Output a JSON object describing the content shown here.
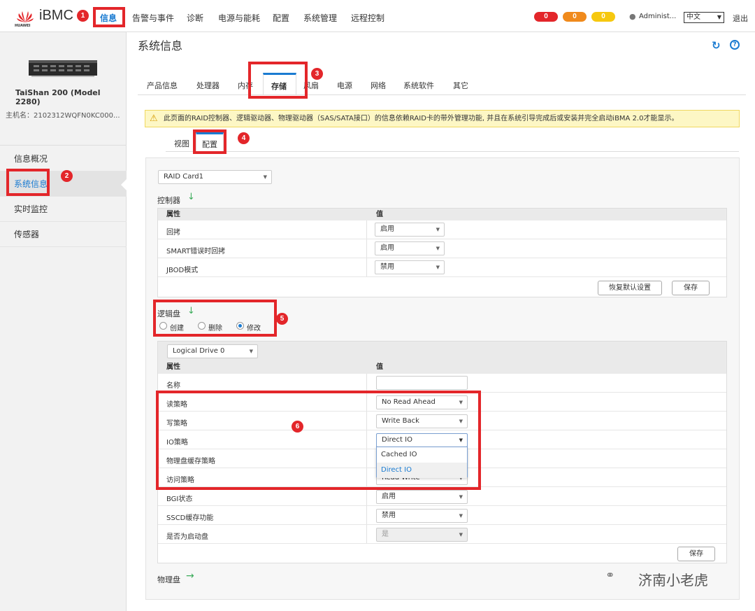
{
  "header": {
    "brand": "iBMC",
    "brand_sub": "HUAWEI",
    "nav": [
      "信息",
      "告警与事件",
      "诊断",
      "电源与能耗",
      "配置",
      "系统管理",
      "远程控制"
    ],
    "alarm_counts": [
      "0",
      "0",
      "0"
    ],
    "alarm_colors": [
      "#e3262a",
      "#f08a1c",
      "#f6c80f"
    ],
    "user": "Administ...",
    "language": "中文",
    "logout": "退出"
  },
  "sidebar": {
    "model": "TaiShan 200 (Model 2280)",
    "hostname": "主机名：2102312WQFN0KC000...",
    "items": [
      "信息概况",
      "系统信息",
      "实时监控",
      "传感器"
    ]
  },
  "main": {
    "title": "系统信息",
    "tabs": [
      "产品信息",
      "处理器",
      "内存",
      "存储",
      "风扇",
      "电源",
      "网络",
      "系统软件",
      "其它"
    ],
    "warning": "此页面的RAID控制器、逻辑驱动器、物理驱动器（SAS/SATA接口）的信息依赖RAID卡的带外管理功能, 并且在系统引导完成后或安装并完全启动iBMA 2.0才能显示。",
    "subtabs": [
      "视图",
      "配置"
    ]
  },
  "controller": {
    "card_select": "RAID Card1",
    "title": "控制器",
    "col_attr": "属性",
    "col_value": "值",
    "rows": [
      {
        "label": "回拷",
        "value": "启用"
      },
      {
        "label": "SMART错误时回拷",
        "value": "启用"
      },
      {
        "label": "JBOD模式",
        "value": "禁用"
      }
    ],
    "restore_btn": "恢复默认设置",
    "save_btn": "保存"
  },
  "logical": {
    "title": "逻辑盘",
    "radios": [
      "创建",
      "删除",
      "修改"
    ],
    "selected_radio": "修改",
    "drive_select": "Logical Drive 0",
    "col_attr": "属性",
    "col_value": "值",
    "rows": [
      {
        "label": "名称",
        "value": ""
      },
      {
        "label": "读策略",
        "value": "No Read Ahead"
      },
      {
        "label": "写策略",
        "value": "Write Back"
      },
      {
        "label": "IO策略",
        "value": "Direct IO"
      },
      {
        "label": "物理盘缓存策略",
        "value": ""
      },
      {
        "label": "访问策略",
        "value": "Read Write"
      },
      {
        "label": "BGI状态",
        "value": "启用"
      },
      {
        "label": "SSCD缓存功能",
        "value": "禁用"
      },
      {
        "label": "是否为启动盘",
        "value": "是"
      }
    ],
    "io_options": [
      "Cached IO",
      "Direct IO"
    ],
    "save_btn": "保存"
  },
  "physical": {
    "title": "物理盘"
  },
  "annotations": [
    "1",
    "2",
    "3",
    "4",
    "5",
    "6"
  ],
  "watermark": "济南小老虎"
}
